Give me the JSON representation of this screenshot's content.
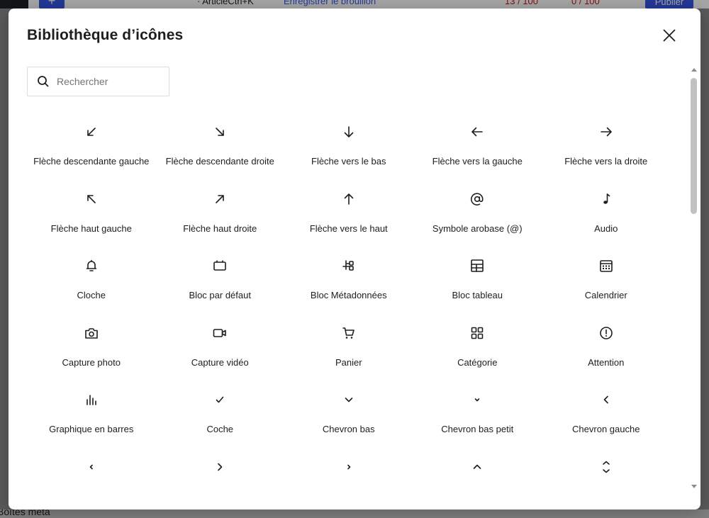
{
  "topbar": {
    "article_shortcut": "· ArticleCtrl+K",
    "save_draft": "Enregistrer le brouillon",
    "seo_score": "13 / 100",
    "readability_score": "0 / 100",
    "publish": "Publier"
  },
  "bottom": {
    "meta_boxes": "Boîtes méta"
  },
  "modal": {
    "title": "Bibliothèque d’icônes",
    "search_placeholder": "Rechercher",
    "search_value": "",
    "icons": [
      {
        "label": "Flèche descendante gauche",
        "icon": "arrow-down-left-icon"
      },
      {
        "label": "Flèche descendante droite",
        "icon": "arrow-down-right-icon"
      },
      {
        "label": "Flèche vers le bas",
        "icon": "arrow-down-icon"
      },
      {
        "label": "Flèche vers la gauche",
        "icon": "arrow-left-icon"
      },
      {
        "label": "Flèche vers la droite",
        "icon": "arrow-right-icon"
      },
      {
        "label": "Flèche haut gauche",
        "icon": "arrow-up-left-icon"
      },
      {
        "label": "Flèche haut droite",
        "icon": "arrow-up-right-icon"
      },
      {
        "label": "Flèche vers le haut",
        "icon": "arrow-up-icon"
      },
      {
        "label": "Symbole arobase (@)",
        "icon": "at-symbol-icon"
      },
      {
        "label": "Audio",
        "icon": "audio-icon"
      },
      {
        "label": "Cloche",
        "icon": "bell-icon"
      },
      {
        "label": "Bloc par défaut",
        "icon": "block-default-icon"
      },
      {
        "label": "Bloc Métadonnées",
        "icon": "block-meta-icon"
      },
      {
        "label": "Bloc tableau",
        "icon": "block-table-icon"
      },
      {
        "label": "Calendrier",
        "icon": "calendar-icon"
      },
      {
        "label": "Capture photo",
        "icon": "camera-icon"
      },
      {
        "label": "Capture vidéo",
        "icon": "video-capture-icon"
      },
      {
        "label": "Panier",
        "icon": "cart-icon"
      },
      {
        "label": "Catégorie",
        "icon": "category-icon"
      },
      {
        "label": "Attention",
        "icon": "attention-icon"
      },
      {
        "label": "Graphique en barres",
        "icon": "bar-chart-icon"
      },
      {
        "label": "Coche",
        "icon": "check-icon"
      },
      {
        "label": "Chevron bas",
        "icon": "chevron-down-icon"
      },
      {
        "label": "Chevron bas petit",
        "icon": "chevron-down-small-icon"
      },
      {
        "label": "Chevron gauche",
        "icon": "chevron-left-icon"
      },
      {
        "label": "",
        "icon": "chevron-left-small-icon"
      },
      {
        "label": "",
        "icon": "chevron-right-icon"
      },
      {
        "label": "",
        "icon": "chevron-right-small-icon"
      },
      {
        "label": "",
        "icon": "chevron-up-icon"
      },
      {
        "label": "",
        "icon": "chevron-up-down-icon"
      }
    ]
  }
}
